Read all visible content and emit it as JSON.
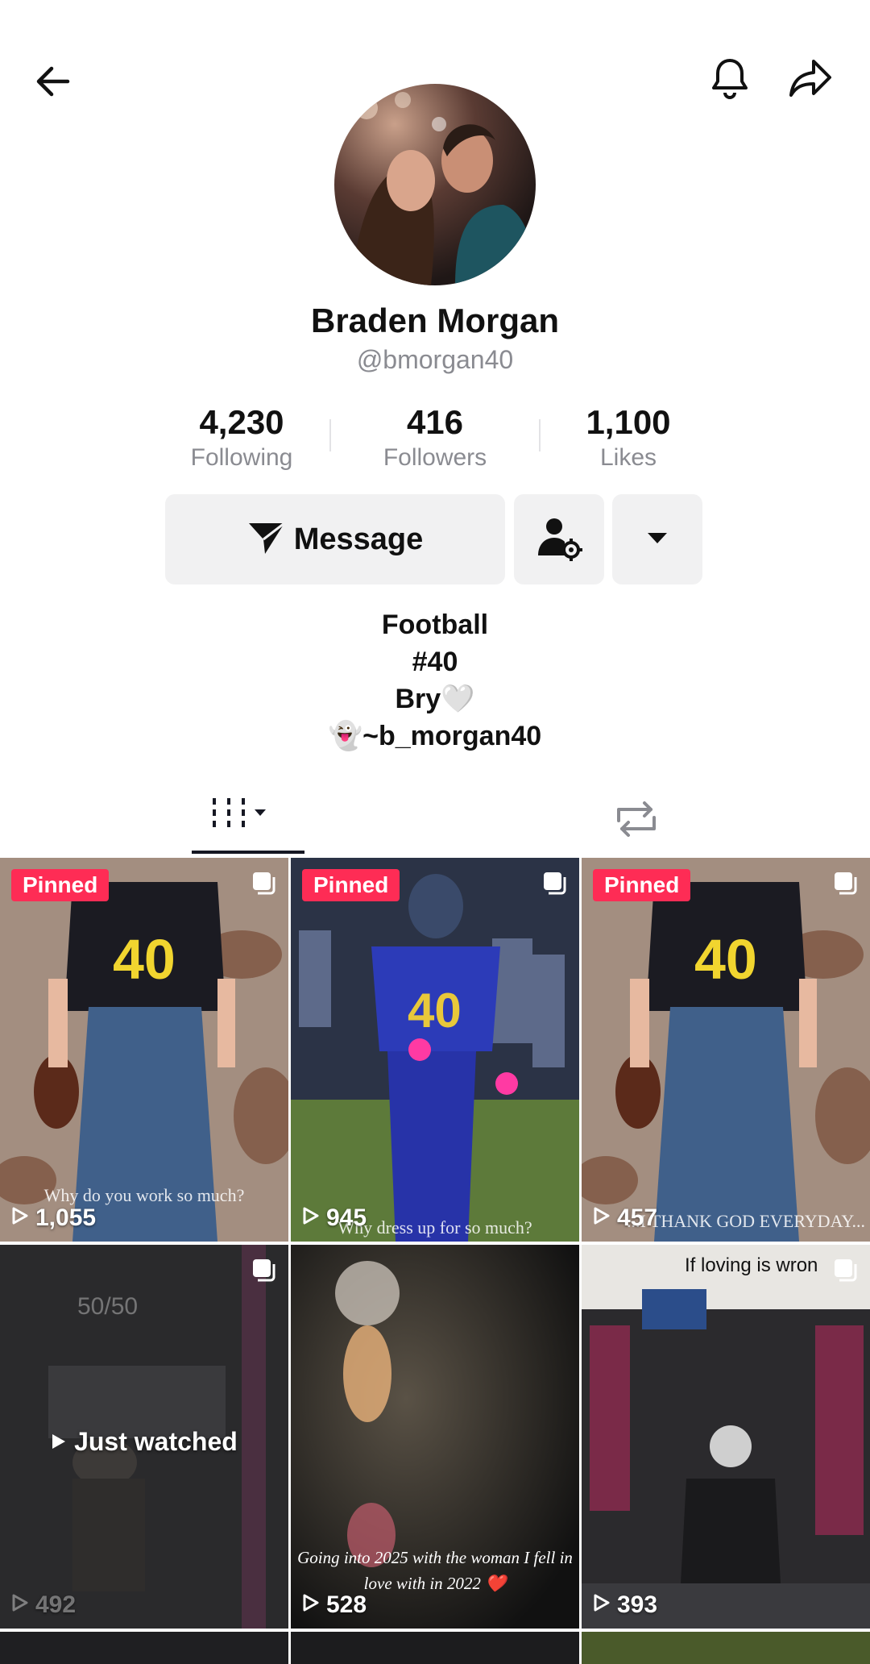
{
  "profile": {
    "name": "Braden Morgan",
    "handle": "@bmorgan40",
    "stats": [
      {
        "value": "4,230",
        "label": "Following"
      },
      {
        "value": "416",
        "label": "Followers"
      },
      {
        "value": "1,100",
        "label": "Likes"
      }
    ],
    "message_label": "Message",
    "bio": [
      "Football",
      "#40",
      "Bry🤍",
      "👻~b_morgan40"
    ]
  },
  "icons": {
    "back": "arrow-left-icon",
    "bell": "bell-icon",
    "share": "share-arrow-icon",
    "send": "send-icon",
    "add_friend": "user-gear-icon",
    "dropdown": "caret-down-icon",
    "videos_tab": "grid-icon",
    "reposts_tab": "repost-icon"
  },
  "videos": [
    {
      "pinned": "Pinned",
      "views": "1,055",
      "caption": "Why do you work so much?"
    },
    {
      "pinned": "Pinned",
      "views": "945",
      "caption": "Why dress up for so much?"
    },
    {
      "pinned": "Pinned",
      "views": "457",
      "caption": "...I THANK GOD EVERYDAY..."
    },
    {
      "views": "492",
      "overlay": "Just watched",
      "caption": "50/50"
    },
    {
      "views": "528",
      "caption": "Going into 2025 with the woman I fell in love with in 2022 ❤️"
    },
    {
      "views": "393",
      "caption": "If loving is wron"
    }
  ],
  "colors": {
    "accent": "#fe2c55",
    "text": "#161823",
    "muted": "#8a8b91",
    "button_bg": "#f1f1f2"
  }
}
